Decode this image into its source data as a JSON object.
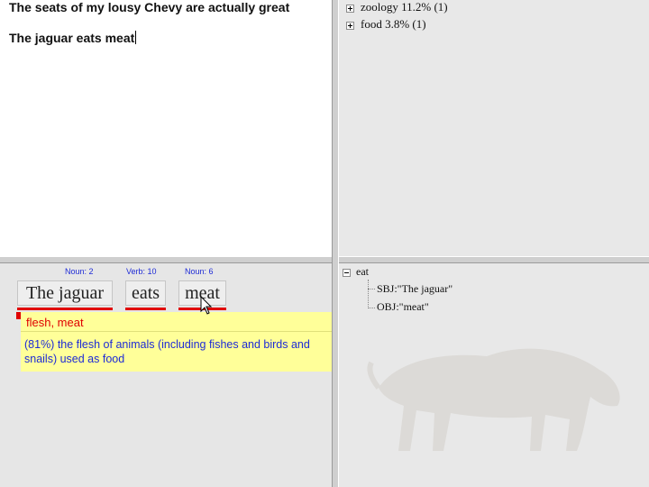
{
  "editor": {
    "lines": [
      "The seats of my lousy Chevy are actually great",
      "The jaguar eats meat"
    ]
  },
  "topics": {
    "items": [
      {
        "label": "zoology 11.2% (1)",
        "expander": "plus"
      },
      {
        "label": "food 3.8% (1)",
        "expander": "plus"
      }
    ]
  },
  "analysis": {
    "tokens": [
      {
        "text": "The jaguar",
        "pos": "Noun: 2"
      },
      {
        "text": "eats",
        "pos": "Verb: 10"
      },
      {
        "text": "meat",
        "pos": "Noun: 6"
      }
    ],
    "suggestion": "flesh, meat",
    "gloss": [
      "(81%) the flesh of animals (including fishes and birds and",
      "snails) used as food"
    ]
  },
  "parse": {
    "root": "eat",
    "children": [
      "SBJ:\"The jaguar\"",
      "OBJ:\"meat\""
    ]
  },
  "colors": {
    "pos_label": "#1e2bd6",
    "underline": "#e00000",
    "tooltip_bg": "#ffff99"
  }
}
